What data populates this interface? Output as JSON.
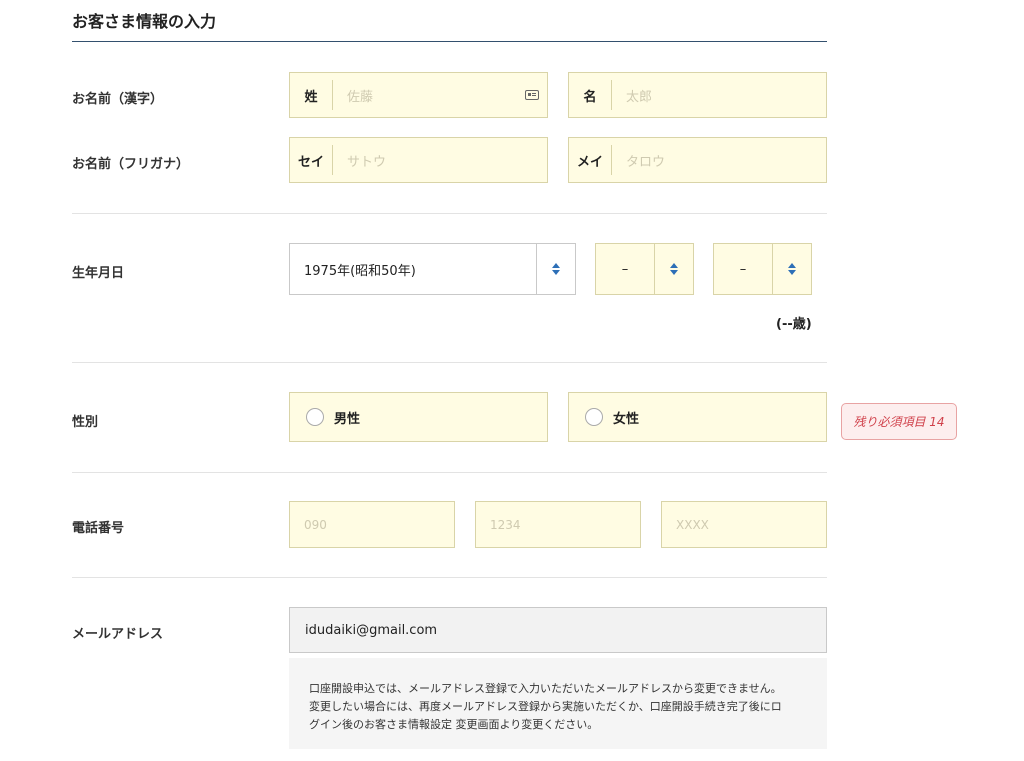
{
  "page_title": "お客さま情報の入力",
  "name_kanji": {
    "label": "お名前（漢字）",
    "last": {
      "prefix": "姓",
      "placeholder": "佐藤"
    },
    "first": {
      "prefix": "名",
      "placeholder": "太郎"
    }
  },
  "name_kana": {
    "label": "お名前（フリガナ）",
    "last": {
      "prefix": "セイ",
      "placeholder": "サトウ"
    },
    "first": {
      "prefix": "メイ",
      "placeholder": "タロウ"
    }
  },
  "birthdate": {
    "label": "生年月日",
    "year": "1975年(昭和50年)",
    "month": "–",
    "day": "–",
    "age": "(--歳)"
  },
  "gender": {
    "label": "性別",
    "options": [
      "男性",
      "女性"
    ]
  },
  "required_badge": "残り必須項目 14",
  "phone": {
    "label": "電話番号",
    "placeholders": [
      "090",
      "1234",
      "XXXX"
    ]
  },
  "email": {
    "label": "メールアドレス",
    "value": "idudaiki@gmail.com",
    "note_lines": [
      "口座開設申込では、メールアドレス登録で入力いただいたメールアドレスから変更できません。",
      "変更したい場合には、再度メールアドレス登録から実施いただくか、口座開設手続き完了後にロ",
      "グイン後のお客さま情報設定 変更画面より変更ください。"
    ]
  },
  "colors": {
    "field_bg": "#fffce3",
    "field_border": "#d9d4a8",
    "accent_blue": "#2d6fb7",
    "badge_red": "#d0404a",
    "title_rule": "#33506e"
  },
  "icons": {
    "contact_card": "contact-card-icon",
    "select_arrows": "updown-arrows-icon"
  }
}
